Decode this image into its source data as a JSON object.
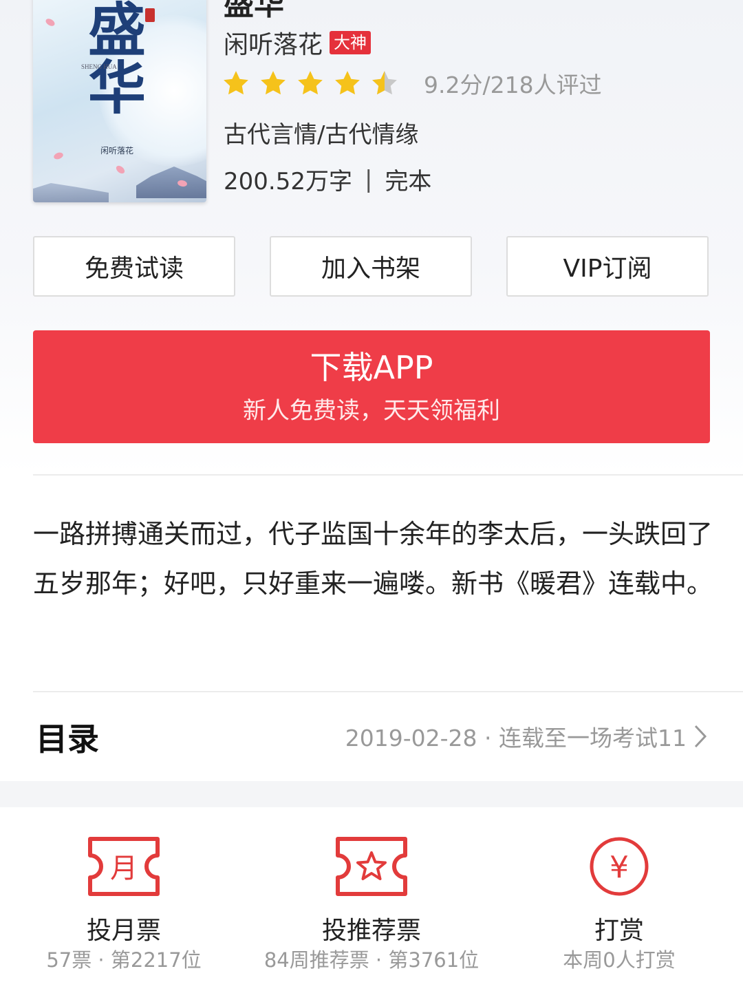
{
  "book": {
    "title_partial": "盛华",
    "author": "闲听落花",
    "author_badge": "大神",
    "rating_text": "9.2分/218人评过",
    "rating_score": 9.2,
    "rating_stars": 4.5,
    "genre": "古代言情/古代情缘",
    "word_count": "200.52万字",
    "status": "完本",
    "cover": {
      "title_art": "盛华",
      "romanized": "SHENG HUA",
      "author": "闲听落花"
    }
  },
  "actions_top": {
    "free_read": "免费试读",
    "add_shelf": "加入书架",
    "vip_subscribe": "VIP订阅"
  },
  "download": {
    "title": "下载APP",
    "subtitle": "新人免费读，天天领福利"
  },
  "description": "一路拼搏通关而过，代子监国十余年的李太后，一头跌回了五岁那年；好吧，只好重来一遍喽。新书《暖君》连载中。",
  "toc": {
    "title": "目录",
    "info": "2019-02-28 · 连载至一场考试11"
  },
  "bottom_actions": [
    {
      "name": "投月票",
      "sub": "57票 · 第2217位",
      "icon": "monthly-ticket-icon",
      "glyph": "月"
    },
    {
      "name": "投推荐票",
      "sub": "84周推荐票 · 第3761位",
      "icon": "recommend-ticket-icon"
    },
    {
      "name": "打赏",
      "sub": "本周0人打赏",
      "icon": "reward-yen-icon",
      "glyph": "¥"
    }
  ],
  "colors": {
    "accent": "#ef3d48",
    "star": "#f5c21b",
    "icon_red": "#e23b3b"
  }
}
